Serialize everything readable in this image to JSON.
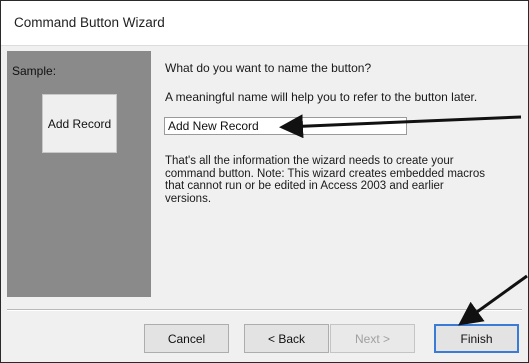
{
  "window": {
    "title": "Command Button Wizard"
  },
  "sample": {
    "label": "Sample:",
    "button_text": "Add Record"
  },
  "prompt": {
    "question": "What do you want to name the button?",
    "hint": "A meaningful name will help you to refer to the button later."
  },
  "name_field": {
    "value": "Add New Record"
  },
  "info_text": "That's all the information the wizard needs to create your command button. Note: This wizard creates embedded macros that cannot run or be edited in Access 2003 and earlier versions.",
  "buttons": {
    "cancel": "Cancel",
    "back": "< Back",
    "next": "Next >",
    "finish": "Finish"
  },
  "colors": {
    "sample_panel": "#8a8a8a",
    "default_button_border": "#3a7bd5",
    "annotation_arrow": "#111111"
  }
}
